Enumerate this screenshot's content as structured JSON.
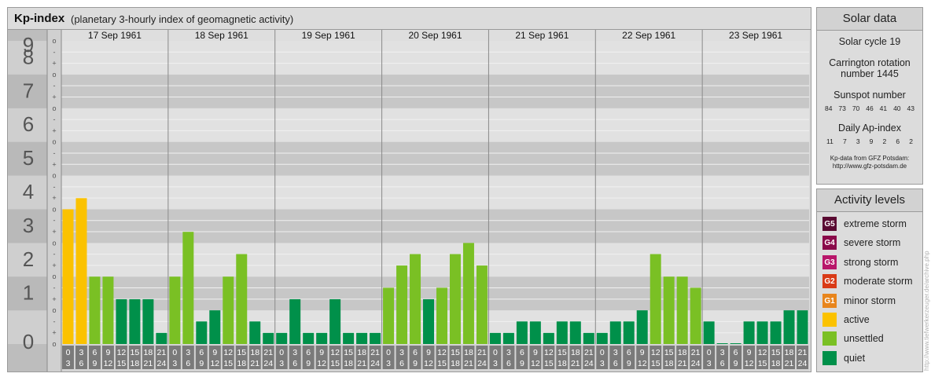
{
  "header": {
    "title": "Kp-index",
    "subtitle": "(planetary 3-hourly index of geomagnetic activity)"
  },
  "chart_data": {
    "type": "bar",
    "ylim": [
      0,
      9
    ],
    "y_tick_labels": [
      "0",
      "1",
      "2",
      "3",
      "4",
      "5",
      "6",
      "7",
      "8",
      "9"
    ],
    "minor_tick_labels": [
      "o",
      "+",
      "-"
    ],
    "days": [
      "17 Sep 1961",
      "18 Sep 1961",
      "19 Sep 1961",
      "20 Sep 1961",
      "21 Sep 1961",
      "22 Sep 1961",
      "23 Sep 1961"
    ],
    "interval_labels": [
      [
        "0",
        "3"
      ],
      [
        "3",
        "6"
      ],
      [
        "6",
        "9"
      ],
      [
        "9",
        "12"
      ],
      [
        "12",
        "15"
      ],
      [
        "15",
        "18"
      ],
      [
        "18",
        "21"
      ],
      [
        "21",
        "24"
      ]
    ],
    "values": [
      [
        4.0,
        4.33,
        2.0,
        2.0,
        1.33,
        1.33,
        1.33,
        0.33
      ],
      [
        2.0,
        3.33,
        0.67,
        1.0,
        2.0,
        2.67,
        0.67,
        0.33
      ],
      [
        0.33,
        1.33,
        0.33,
        0.33,
        1.33,
        0.33,
        0.33,
        0.33
      ],
      [
        1.67,
        2.33,
        2.67,
        1.33,
        1.67,
        2.67,
        3.0,
        2.33
      ],
      [
        0.33,
        0.33,
        0.67,
        0.67,
        0.33,
        0.67,
        0.67,
        0.33
      ],
      [
        0.33,
        0.67,
        0.67,
        1.0,
        2.67,
        2.0,
        2.0,
        1.67
      ],
      [
        0.67,
        0.0,
        0.0,
        0.67,
        0.67,
        0.67,
        1.0,
        1.0
      ]
    ],
    "colors": {
      "active": "#fbc200",
      "unsettled": "#7ac024",
      "quiet": "#00904a"
    }
  },
  "solar": {
    "title": "Solar data",
    "cycle": "Solar cycle 19",
    "carrington_line1": "Carrington rotation",
    "carrington_line2": "number 1445",
    "sunspot_label": "Sunspot number",
    "sunspot_values": [
      "84",
      "73",
      "70",
      "46",
      "41",
      "40",
      "43"
    ],
    "ap_label": "Daily Ap-index",
    "ap_values": [
      "11",
      "7",
      "3",
      "9",
      "2",
      "6",
      "2"
    ],
    "credit_line1": "Kp-data from GFZ Potsdam:",
    "credit_line2": "http://www.gfz-potsdam.de"
  },
  "activity": {
    "title": "Activity levels",
    "levels": [
      {
        "code": "G5",
        "label": "extreme storm",
        "color": "#5a0a32"
      },
      {
        "code": "G4",
        "label": "severe storm",
        "color": "#8a0a4a"
      },
      {
        "code": "G3",
        "label": "strong storm",
        "color": "#b8166a"
      },
      {
        "code": "G2",
        "label": "moderate storm",
        "color": "#d93a16"
      },
      {
        "code": "G1",
        "label": "minor storm",
        "color": "#e8851c"
      },
      {
        "code": "",
        "label": "active",
        "color": "#fbc200"
      },
      {
        "code": "",
        "label": "unsettled",
        "color": "#7ac024"
      },
      {
        "code": "",
        "label": "quiet",
        "color": "#00904a"
      }
    ]
  },
  "side_credit": "http://www.tiefwerkerzeuger.de/archive.php"
}
